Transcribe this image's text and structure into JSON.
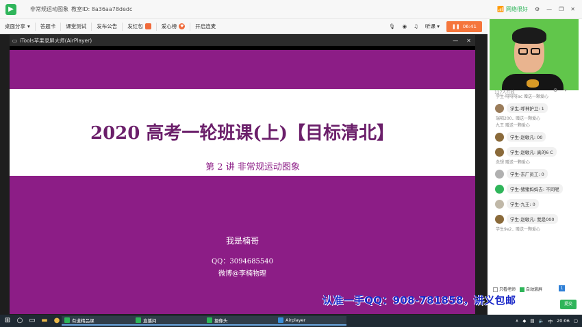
{
  "titlebar": {
    "title": "非常规运动图象",
    "room_id": "教室ID: 8a36aa78dedc",
    "network": "网络很好"
  },
  "toolbar": {
    "items": [
      "桌面分享",
      "答题卡",
      "课堂测试",
      "发布公告",
      "发红包",
      "爱心榜",
      "开启连麦"
    ],
    "listen": "听课",
    "record_time": "06:41"
  },
  "air_window": {
    "title": "iTools苹果录屏大师(AirPlayer)"
  },
  "slide": {
    "title": "2020 高考一轮班课(上)【目标清北】",
    "subtitle": "第 2 讲  非常规运动图象",
    "presenter": "我是楠哥",
    "qq": "QQ：3094685540",
    "weibo": "微博@李楠物理"
  },
  "panel": {
    "online": "127人在线",
    "chat": [
      {
        "type": "sys",
        "text": "学生-呀呀呀ac 赠送一颗爱心"
      },
      {
        "type": "msg",
        "text": "学生-呼神护卫: 1",
        "color": "#9a7c5a"
      },
      {
        "type": "sys",
        "text": "瑞昭200.. 赠送一颗爱心"
      },
      {
        "type": "sys",
        "text": "九王 赠送一颗爱心"
      },
      {
        "type": "msg",
        "text": "学生-赵敏凡: 00",
        "color": "#8a6a3a"
      },
      {
        "type": "msg",
        "text": "学生-赵敏凡: 真的6 C",
        "color": "#8a6a3a"
      },
      {
        "type": "sys",
        "text": "念想 赠送一颗爱心"
      },
      {
        "type": "msg",
        "text": "学生-东厂员工: 0",
        "color": "#b0b0b0"
      },
      {
        "type": "msg",
        "text": "学生-猪猪妈妈去: 不同呢",
        "color": "#2fb55a"
      },
      {
        "type": "msg",
        "text": "学生-九王: 0",
        "color": "#c0b8a8"
      },
      {
        "type": "msg",
        "text": "学生-赵敏凡: 我是000",
        "color": "#8a6a3a"
      },
      {
        "type": "sys",
        "text": "学生9e2.. 赠送一颗爱心"
      }
    ],
    "only_teacher": "只看老师",
    "auto_scroll": "自动滚屏",
    "count": "1",
    "send": "提交"
  },
  "overlay": "认准一手QQ：908-781858，讲义包邮",
  "taskbar": {
    "apps": [
      "有道精品课",
      "直播间",
      "摄像头",
      "Airplayer"
    ],
    "lang": "中",
    "time": "20:06"
  }
}
